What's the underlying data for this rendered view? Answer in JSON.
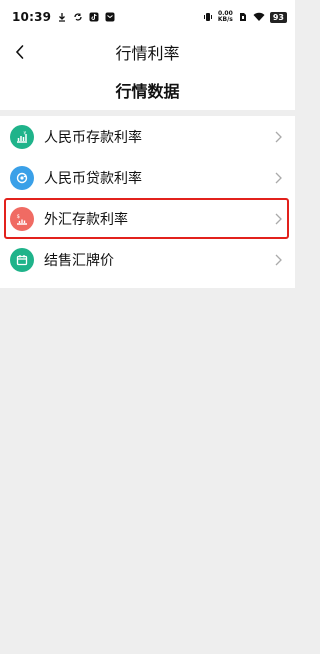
{
  "status_bar": {
    "time": "10:39",
    "speed_value": "0.00",
    "speed_unit": "KB/s",
    "battery": "93"
  },
  "header": {
    "title": "行情利率"
  },
  "section": {
    "title": "行情数据"
  },
  "items": [
    {
      "label": "人民币存款利率",
      "icon": "deposit-chart-icon",
      "color": "#1fb38a",
      "highlighted": false
    },
    {
      "label": "人民币贷款利率",
      "icon": "loan-cycle-icon",
      "color": "#3aa0e8",
      "highlighted": false
    },
    {
      "label": "外汇存款利率",
      "icon": "forex-deposit-icon",
      "color": "#f06b63",
      "highlighted": true
    },
    {
      "label": "结售汇牌价",
      "icon": "calendar-icon",
      "color": "#1fb38a",
      "highlighted": false
    }
  ],
  "colors": {
    "highlight_border": "#e2211c",
    "background": "#eeeeee"
  }
}
